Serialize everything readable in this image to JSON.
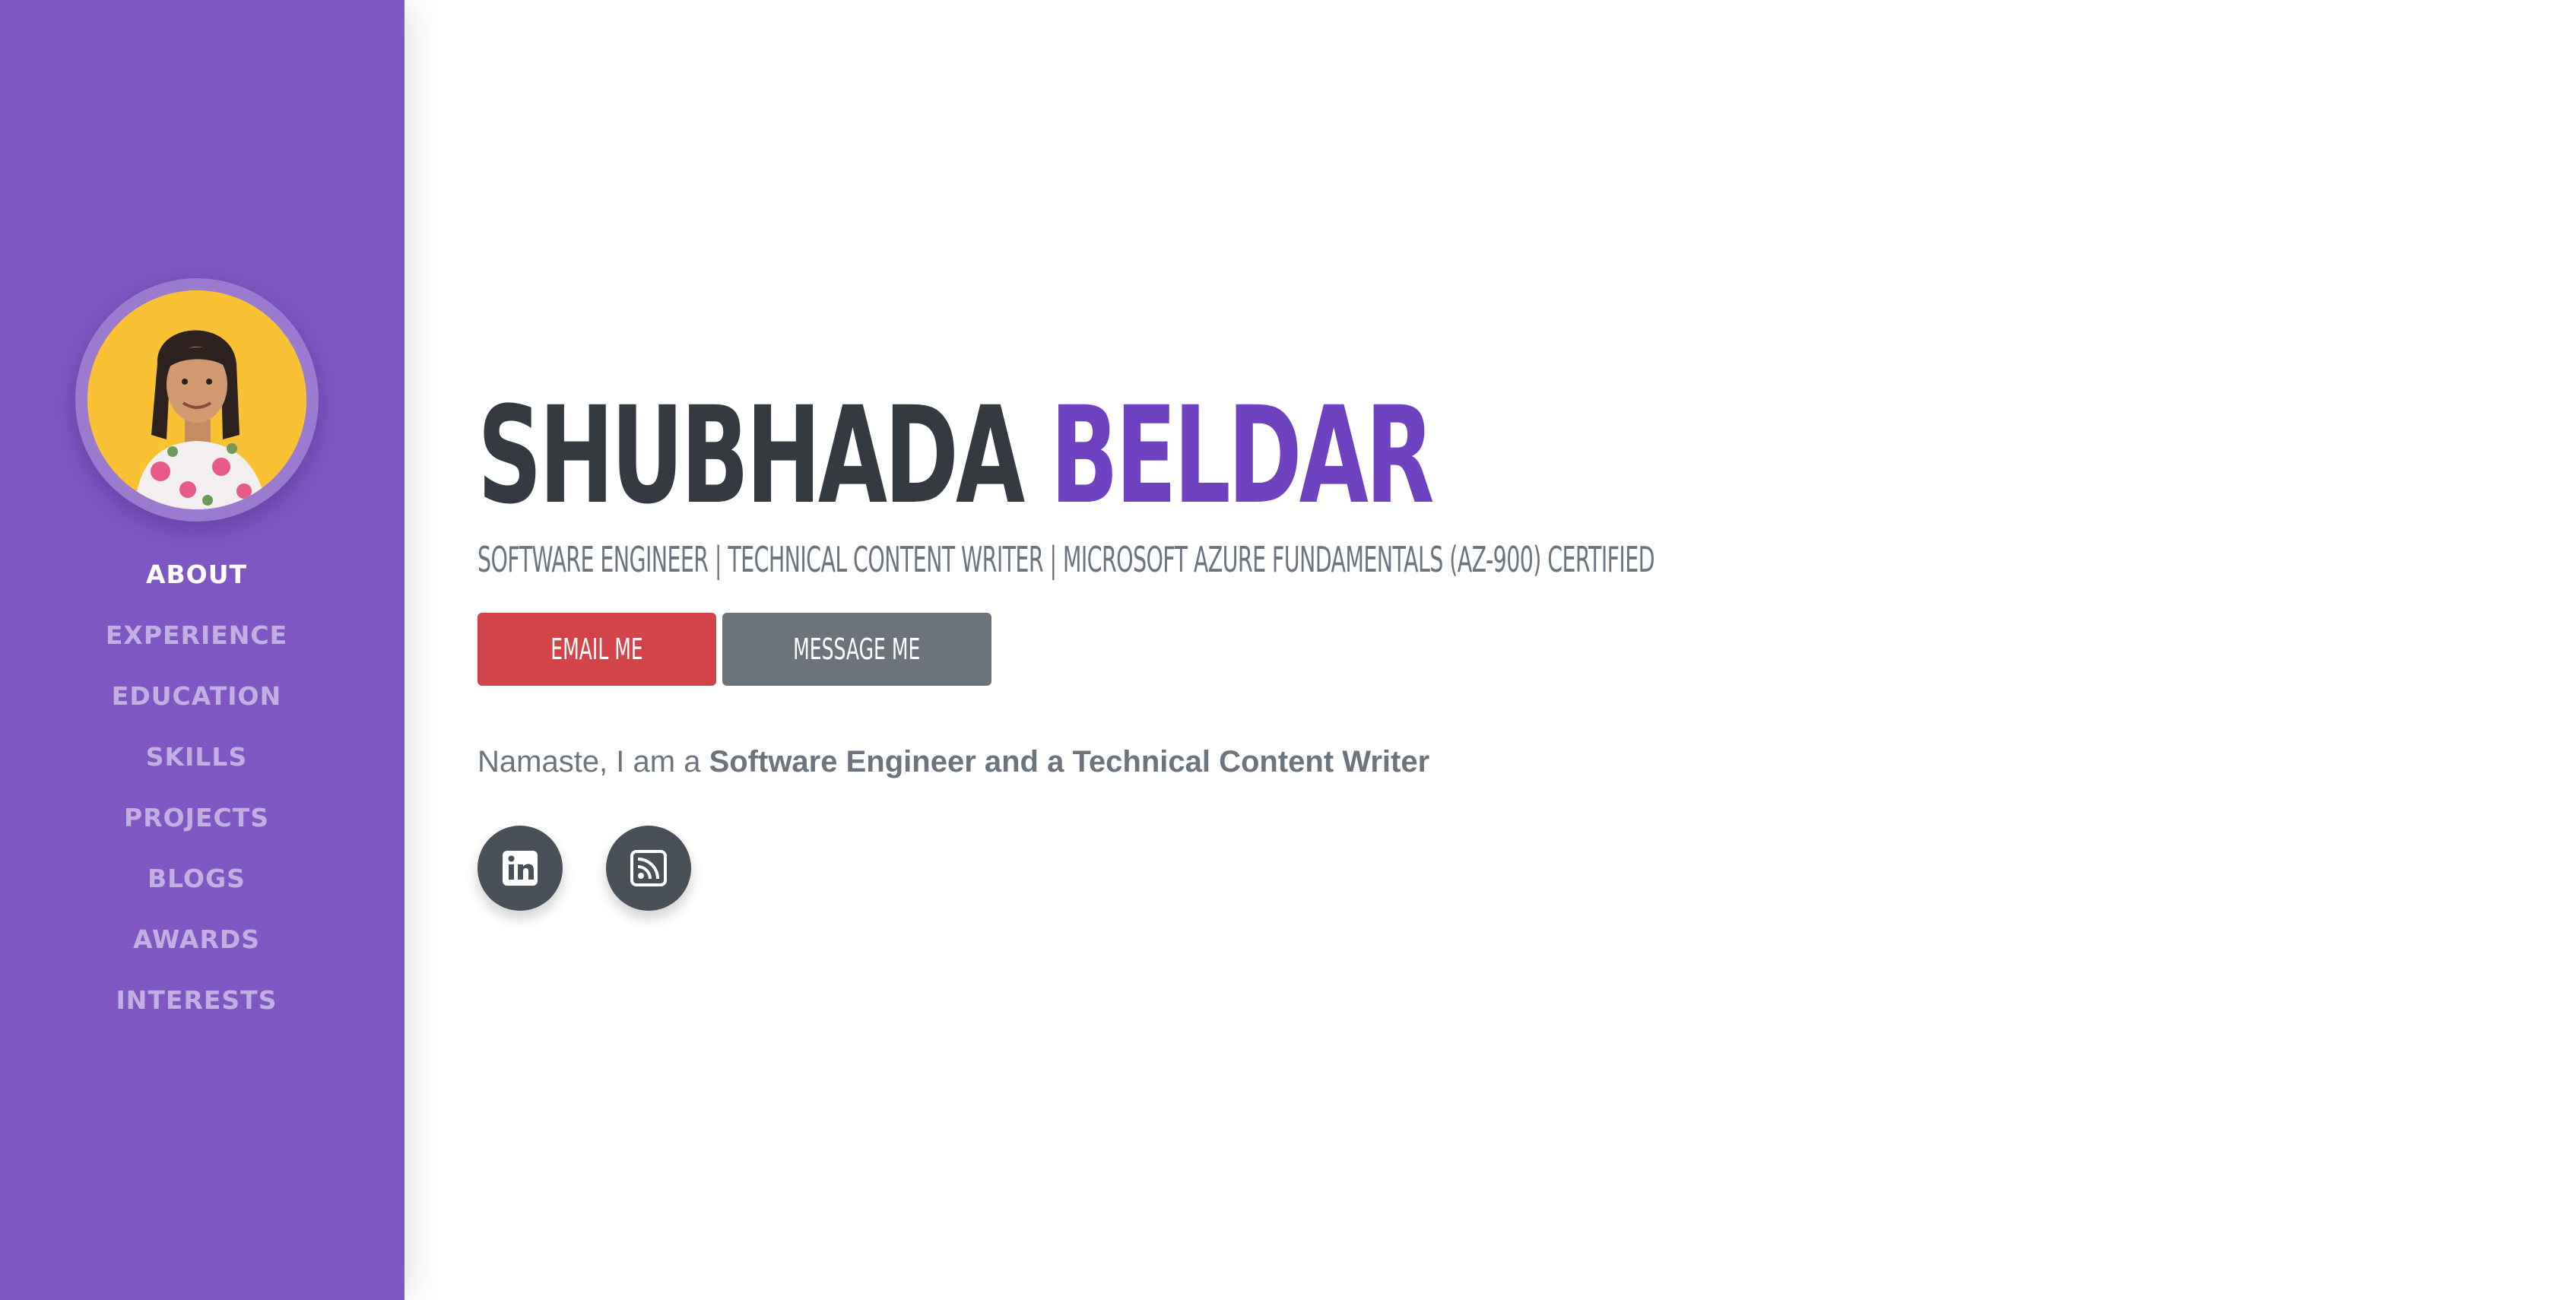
{
  "sidebar": {
    "nav": [
      {
        "label": "ABOUT"
      },
      {
        "label": "EXPERIENCE"
      },
      {
        "label": "EDUCATION"
      },
      {
        "label": "SKILLS"
      },
      {
        "label": "PROJECTS"
      },
      {
        "label": "BLOGS"
      },
      {
        "label": "AWARDS"
      },
      {
        "label": "INTERESTS"
      }
    ],
    "active_item": "ABOUT"
  },
  "about": {
    "first_name": "SHUBHADA",
    "last_name": "BELDAR",
    "subheading": "SOFTWARE ENGINEER | TECHNICAL CONTENT WRITER | MICROSOFT AZURE FUNDAMENTALS (AZ-900) CERTIFIED",
    "email_button": "EMAIL ME",
    "message_button": "MESSAGE ME",
    "intro_prefix": "Namaste, I am a ",
    "intro_bold": "Software Engineer and a Technical Content Writer"
  },
  "social": [
    {
      "icon": "linkedin-icon"
    },
    {
      "icon": "rss-icon"
    }
  ],
  "colors": {
    "sidebar": "#7e57c2",
    "accent": "#6f42c1",
    "email_button": "#d2434a",
    "message_button": "#6c737b",
    "social_button": "#495057",
    "avatar_background": "#f8c234"
  }
}
